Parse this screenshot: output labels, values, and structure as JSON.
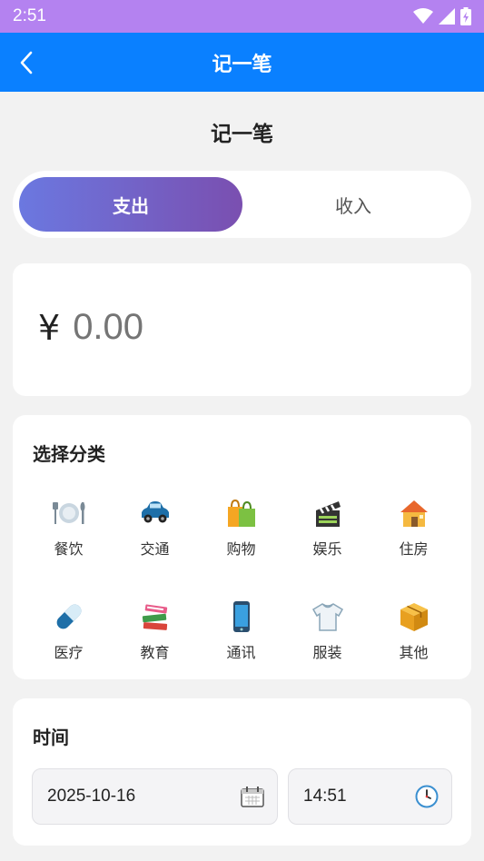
{
  "status_bar": {
    "time": "2:51",
    "icons": [
      "wifi-icon",
      "signal-icon",
      "battery-charging-icon"
    ]
  },
  "app_bar": {
    "title": "记一笔",
    "back_icon": "chevron-left-icon"
  },
  "page_heading": "记一笔",
  "type_toggle": {
    "expense_label": "支出",
    "income_label": "收入",
    "selected": "expense"
  },
  "amount": {
    "currency_symbol": "¥",
    "placeholder": "0.00"
  },
  "category": {
    "title": "选择分类",
    "items": [
      {
        "label": "餐饮",
        "icon": "dining-icon"
      },
      {
        "label": "交通",
        "icon": "car-icon"
      },
      {
        "label": "购物",
        "icon": "shopping-bag-icon"
      },
      {
        "label": "娱乐",
        "icon": "clapper-icon"
      },
      {
        "label": "住房",
        "icon": "house-icon"
      },
      {
        "label": "医疗",
        "icon": "pill-icon"
      },
      {
        "label": "教育",
        "icon": "books-icon"
      },
      {
        "label": "通讯",
        "icon": "phone-icon"
      },
      {
        "label": "服装",
        "icon": "shirt-icon"
      },
      {
        "label": "其他",
        "icon": "box-icon"
      }
    ]
  },
  "time_section": {
    "title": "时间",
    "date_value": "2025-10-16",
    "time_value": "14:51",
    "date_icon": "calendar-icon",
    "time_icon": "clock-icon"
  },
  "colors": {
    "status_bar": "#b482f0",
    "app_bar": "#0a80ff",
    "toggle_start": "#6b78e0",
    "toggle_end": "#7a4fb0",
    "background": "#f2f2f2"
  }
}
